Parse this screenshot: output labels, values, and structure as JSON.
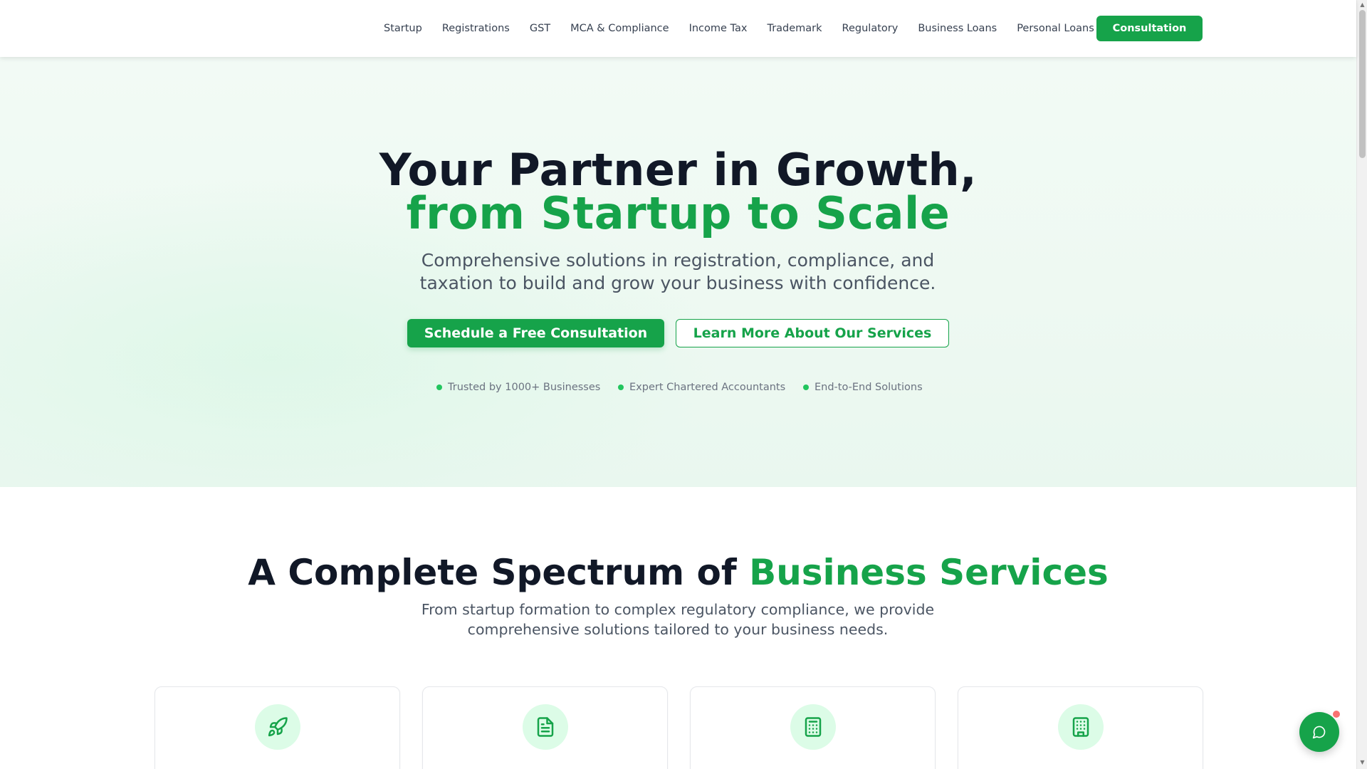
{
  "colors": {
    "brand": "#16a34a",
    "heading": "#111827",
    "body": "#4b5563",
    "icon_bg": "#dcfce7",
    "badge": "#f87171"
  },
  "nav": {
    "items": [
      "Startup",
      "Registrations",
      "GST",
      "MCA & Compliance",
      "Income Tax",
      "Trademark",
      "Regulatory",
      "Business Loans",
      "Personal Loans"
    ],
    "cta": "Consultation"
  },
  "hero": {
    "title_line1": "Your Partner in Growth,",
    "title_line2": "from Startup to Scale",
    "subtitle": "Comprehensive solutions in registration, compliance, and taxation to build and grow your business with confidence.",
    "primary_button": "Schedule a Free Consultation",
    "secondary_button": "Learn More About Our Services",
    "trust_points": [
      "Trusted by 1000+ Businesses",
      "Expert Chartered Accountants",
      "End-to-End Solutions"
    ]
  },
  "services": {
    "title_plain": "A Complete Spectrum of",
    "title_accent": "Business Services",
    "subtitle": "From startup formation to complex regulatory compliance, we provide comprehensive solutions tailored to your business needs.",
    "cards": [
      {
        "icon": "rocket-icon"
      },
      {
        "icon": "document-icon"
      },
      {
        "icon": "calculator-icon"
      },
      {
        "icon": "building-icon"
      }
    ]
  },
  "chat": {
    "icon": "message-circle-icon"
  }
}
